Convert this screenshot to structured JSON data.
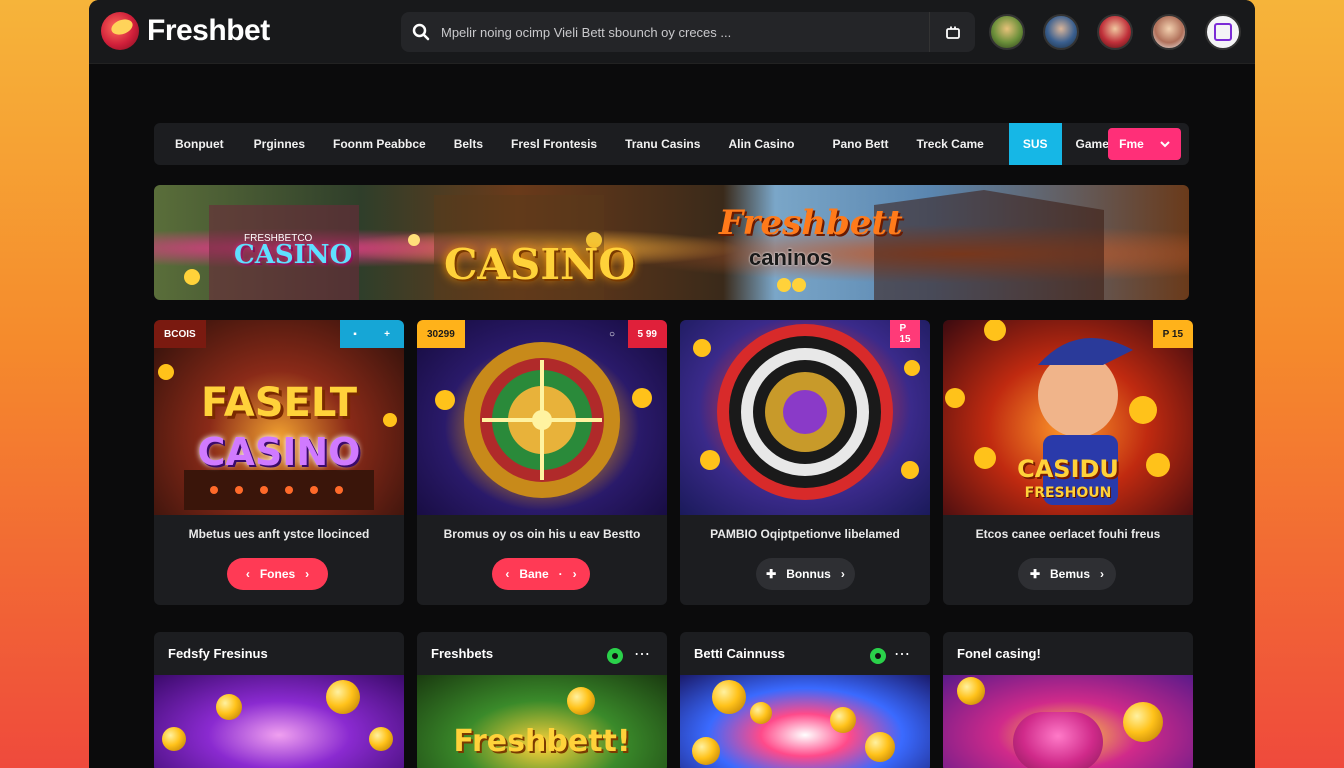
{
  "app": {
    "logo_text": "Freshbet"
  },
  "search": {
    "placeholder": "Mpelir noing ocimp Vieli Bett sbounch oy creces ..."
  },
  "nav": {
    "items": [
      "Bonpuet",
      "Prginnes",
      "Foonm Peabbce",
      "Belts",
      "Fresl Frontesis",
      "Tranu Casins",
      "Alin Casino",
      "Pano Bett",
      "Treck Came",
      "SUS",
      "Games"
    ],
    "active_index": 9,
    "select_label": "Fme"
  },
  "banner": {
    "left_title": "CASINO",
    "left_sub": "FRESHBETCO",
    "center_title": "CASINO",
    "right_title": "Freshbett",
    "right_sub": "caninos"
  },
  "cards": [
    {
      "tag_left": "BCOIS",
      "tag_right_1": "",
      "tag_right_2": "",
      "art_line1": "FASELT",
      "art_line2": "CASINO",
      "caption": "Mbetus ues anft ystce llocinced",
      "button_label": "Fones",
      "button_style": "red"
    },
    {
      "tag_left": "30299",
      "tag_right_1": "",
      "tag_right_2": "5 99",
      "art_line1": "",
      "art_line2": "",
      "caption": "Bromus oy os oin his u eav Bestto",
      "button_label": "Bane",
      "button_style": "red"
    },
    {
      "tag_left": "",
      "tag_right_1": "",
      "tag_right_2": "P 15",
      "art_line1": "",
      "art_line2": "",
      "caption": "PAMBIO Oqiptpetionve libelamed",
      "button_label": "Bonnus",
      "button_style": "dark"
    },
    {
      "tag_left": "",
      "tag_right_1": "",
      "tag_right_2": "P 15",
      "art_line1": "CASIDU",
      "art_line2": "FRESHOUN",
      "caption": "Etcos canee oerlacet fouhi freus",
      "button_label": "Bemus",
      "button_style": "dark"
    }
  ],
  "cards_bottom": [
    {
      "title": "Fedsfy Fresinus",
      "art": ""
    },
    {
      "title": "Freshbets",
      "art": "Freshbett!"
    },
    {
      "title": "Betti Cainnuss",
      "art": ""
    },
    {
      "title": "Fonel casing!",
      "art": ""
    }
  ],
  "colors": {
    "accent": "#ff2f78",
    "active_tab": "#16b7e6",
    "button_red": "#ff3a55"
  }
}
